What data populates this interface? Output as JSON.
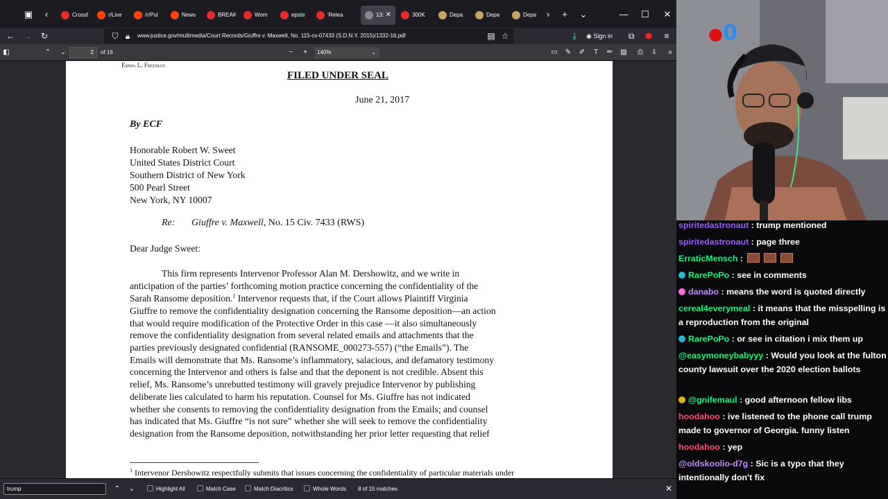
{
  "browser": {
    "tabs": [
      {
        "label": "Crossf",
        "color": "#e52d27"
      },
      {
        "label": "r/Live",
        "color": "#ff4500"
      },
      {
        "label": "/r/Pul",
        "color": "#ff4500"
      },
      {
        "label": "News",
        "color": "#ff4500"
      },
      {
        "label": "BREAK",
        "color": "#e52d27"
      },
      {
        "label": "Wom",
        "color": "#e52d27"
      },
      {
        "label": "epste",
        "color": "#e52d27"
      },
      {
        "label": "'Relea",
        "color": "#e52d27"
      },
      {
        "label": "13:",
        "color": "#888888",
        "active": true
      },
      {
        "label": "300K",
        "color": "#e52d27"
      },
      {
        "label": "Depa",
        "color": "#c8a35b"
      },
      {
        "label": "Depa",
        "color": "#c8a35b"
      },
      {
        "label": "Depa",
        "color": "#c8a35b"
      }
    ],
    "url": "www.justice.gov/multimedia/Court Records/Giuffre v. Maxwell, No. 115-cv-07433 (S.D.N.Y. 2015)/1332-16.pdf",
    "signin_label": "Sign in"
  },
  "pdf": {
    "page_number": "2",
    "page_total": "of 16",
    "zoom": "140%"
  },
  "document": {
    "sender": "Emma L. Freeman",
    "filed_under_seal": "FILED UNDER SEAL",
    "date": "June 21, 2017",
    "by_ecf": "By ECF",
    "address": [
      "Honorable Robert W. Sweet",
      "United States District Court",
      "Southern District of New York",
      "500 Pearl Street",
      "New York, NY 10007"
    ],
    "re_label": "Re:",
    "re_case": "Giuffre v. Maxwell,",
    "re_rest": " No. 15 Civ. 7433 (RWS)",
    "salutation": "Dear Judge Sweet:",
    "body_lines": [
      "This firm represents Intervenor Professor Alan M. Dershowitz, and we write in",
      "anticipation of the parties’ forthcoming motion practice concerning the confidentiality of the",
      "Sarah Ransome deposition.",
      "Giuffre to remove the confidentiality designation concerning the Ransome deposition—an action",
      "that would require modification of the Protective Order in this case —it also simultaneously",
      "remove the confidentiality designation from several related emails and attachments that the",
      "parties previously designated confidential (RANSOME_000273-557) (“the Emails”).  The",
      "Emails will demonstrate that Ms. Ransome’s inflammatory, salacious, and defamatory testimony",
      "concerning the Intervenor and others is false and that the deponent is not credible.  Absent this",
      "relief, Ms. Ransome’s unrebutted testimony will gravely prejudice Intervenor by publishing",
      "deliberate lies calculated to harm his reputation.  Counsel for Ms. Giuffre has not indicated",
      "whether she consents to removing the confidentiality designation from the Emails; and counsel",
      "has indicated that Ms. Giuffre “is not sure” whether she will seek to remove the confidentiality",
      "designation from the Ransome deposition, notwithstanding her prior letter requesting that relief"
    ],
    "footnote_mark": "1",
    "line3_rest": "  Intervenor requests that, if the Court allows Plaintiff Virginia",
    "footnote_text": " Intervenor Dershowitz respectfully submits that issues concerning the confidentiality of particular materials under"
  },
  "findbar": {
    "query": "trump",
    "options": [
      "Highlight All",
      "Match Case",
      "Match Diacritics",
      "Whole Words"
    ],
    "matches": "8 of 15 matches"
  },
  "stream": {
    "counter": "0",
    "chat": [
      {
        "user": "spiritedastronaut",
        "color": "#9b59ff",
        "text": "trump mentioned"
      },
      {
        "user": "spiritedastronaut",
        "color": "#9b59ff",
        "text": "page three"
      },
      {
        "user": "ErraticMensch",
        "color": "#00ff7f",
        "text": "",
        "emotes": 3
      },
      {
        "user": "RarePoPo",
        "color": "#00ff7f",
        "text": "see in comments",
        "badge": "#2bb5c9"
      },
      {
        "user": "danabo",
        "color": "#c28cff",
        "text": "means the word is quoted directly",
        "badge": "#ff6bd6"
      },
      {
        "user": "cereal4everymeal",
        "color": "#00ff7f",
        "text": "it means that the misspelling is a reproduction from the original"
      },
      {
        "user": "RarePoPo",
        "color": "#00ff7f",
        "text": "or see in citation i mix them up",
        "badge": "#2bb5c9"
      },
      {
        "user": "@easymoneybabyyy",
        "color": "#00ff7f",
        "text": "Would you look at the fulton county lawsuit over the 2020 election ballots"
      },
      {
        "user": "@gnifemaul",
        "color": "#00ff7f",
        "text": "good afternoon fellow libs",
        "badge": "#e0b020"
      },
      {
        "user": "hoodahoo",
        "color": "#ff4b6e",
        "text": "ive listened to the phone call trump made to governor of Georgia. funny listen"
      },
      {
        "user": "hoodahoo",
        "color": "#ff4b6e",
        "text": "yep"
      },
      {
        "user": "@oldskoolio-d7g",
        "color": "#c28cff",
        "text": "Sic is a typo that they intentionally don't fix"
      }
    ]
  }
}
